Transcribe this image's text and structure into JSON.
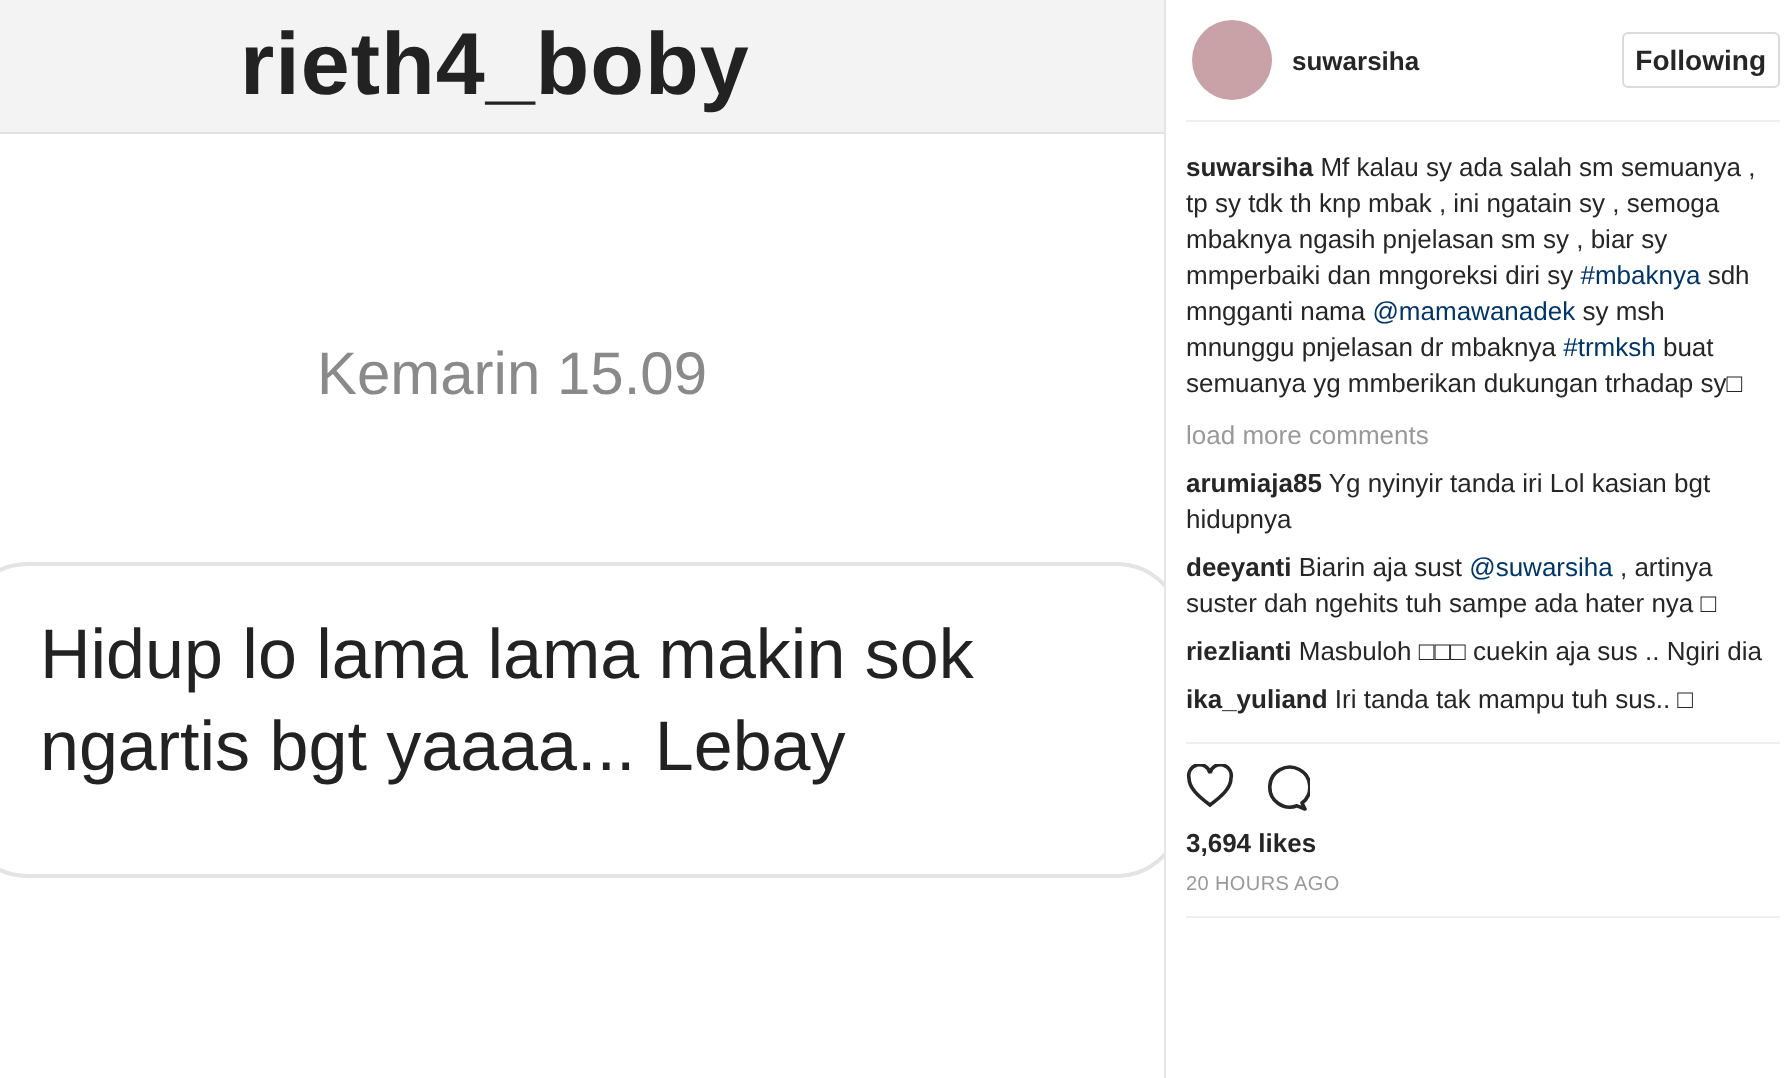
{
  "photo": {
    "chat_title": "rieth4_boby",
    "timestamp": "Kemarin 15.09",
    "message": "Hidup lo lama lama makin sok ngartis bgt yaaaa... Lebay"
  },
  "header": {
    "username": "suwarsiha",
    "follow_button": "Following"
  },
  "caption": {
    "parts": [
      {
        "kind": "user",
        "text": "suwarsiha"
      },
      {
        "kind": "text",
        "text": " Mf kalau sy ada salah sm semuanya , tp sy tdk th knp mbak , ini ngatain sy , semoga mbaknya ngasih pnjelasan sm sy , biar sy mmperbaiki dan mngoreksi diri sy "
      },
      {
        "kind": "link",
        "text": "#mbaknya"
      },
      {
        "kind": "text",
        "text": " sdh mngganti nama "
      },
      {
        "kind": "link",
        "text": "@mamawanadek"
      },
      {
        "kind": "text",
        "text": " sy msh mnunggu pnjelasan dr mbaknya "
      },
      {
        "kind": "link",
        "text": "#trmksh"
      },
      {
        "kind": "text",
        "text": " buat semuanya yg mmberikan dukungan trhadap sy□"
      }
    ]
  },
  "load_more": "load more comments",
  "comments": [
    {
      "parts": [
        {
          "kind": "user",
          "text": "arumiaja85"
        },
        {
          "kind": "text",
          "text": " Yg nyinyir tanda iri Lol kasian bgt hidupnya"
        }
      ]
    },
    {
      "parts": [
        {
          "kind": "user",
          "text": "deeyanti"
        },
        {
          "kind": "text",
          "text": " Biarin aja sust "
        },
        {
          "kind": "link",
          "text": "@suwarsiha"
        },
        {
          "kind": "text",
          "text": " , artinya suster dah ngehits tuh sampe ada hater nya □"
        }
      ]
    },
    {
      "parts": [
        {
          "kind": "user",
          "text": "riezlianti"
        },
        {
          "kind": "text",
          "text": " Masbuloh □□□ cuekin aja sus .. Ngiri dia"
        }
      ]
    },
    {
      "parts": [
        {
          "kind": "user",
          "text": "ika_yuliand"
        },
        {
          "kind": "text",
          "text": " Iri tanda tak mampu tuh sus.. □"
        }
      ]
    }
  ],
  "likes": "3,694 likes",
  "time": "20 HOURS AGO"
}
